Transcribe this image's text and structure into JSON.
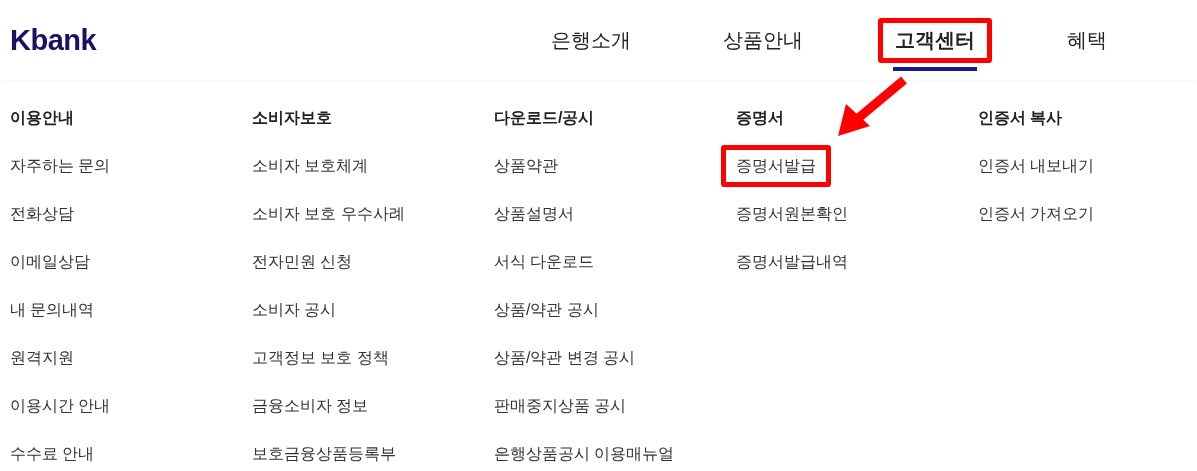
{
  "logo": "Kbank",
  "nav": [
    {
      "label": "은행소개",
      "selected": false,
      "highlighted": false
    },
    {
      "label": "상품안내",
      "selected": false,
      "highlighted": false
    },
    {
      "label": "고객센터",
      "selected": true,
      "highlighted": true
    },
    {
      "label": "혜택",
      "selected": false,
      "highlighted": false
    }
  ],
  "menu_columns": [
    {
      "heading": "이용안내",
      "items": [
        {
          "label": "자주하는 문의",
          "highlighted": false
        },
        {
          "label": "전화상담",
          "highlighted": false
        },
        {
          "label": "이메일상담",
          "highlighted": false
        },
        {
          "label": "내 문의내역",
          "highlighted": false
        },
        {
          "label": "원격지원",
          "highlighted": false
        },
        {
          "label": "이용시간 안내",
          "highlighted": false
        },
        {
          "label": "수수료 안내",
          "highlighted": false
        }
      ]
    },
    {
      "heading": "소비자보호",
      "items": [
        {
          "label": "소비자 보호체계",
          "highlighted": false
        },
        {
          "label": "소비자 보호 우수사례",
          "highlighted": false
        },
        {
          "label": "전자민원 신청",
          "highlighted": false
        },
        {
          "label": "소비자 공시",
          "highlighted": false
        },
        {
          "label": "고객정보 보호 정책",
          "highlighted": false
        },
        {
          "label": "금융소비자 정보",
          "highlighted": false
        },
        {
          "label": "보호금융상품등록부",
          "highlighted": false
        }
      ]
    },
    {
      "heading": "다운로드/공시",
      "items": [
        {
          "label": "상품약관",
          "highlighted": false
        },
        {
          "label": "상품설명서",
          "highlighted": false
        },
        {
          "label": "서식 다운로드",
          "highlighted": false
        },
        {
          "label": "상품/약관 공시",
          "highlighted": false
        },
        {
          "label": "상품/약관 변경 공시",
          "highlighted": false
        },
        {
          "label": "판매중지상품 공시",
          "highlighted": false
        },
        {
          "label": "은행상품공시 이용매뉴얼",
          "highlighted": false
        }
      ]
    },
    {
      "heading": "증명서",
      "items": [
        {
          "label": "증명서발급",
          "highlighted": true
        },
        {
          "label": "증명서원본확인",
          "highlighted": false
        },
        {
          "label": "증명서발급내역",
          "highlighted": false
        }
      ]
    },
    {
      "heading": "인증서 복사",
      "items": [
        {
          "label": "인증서 내보내기",
          "highlighted": false
        },
        {
          "label": "인증서 가져오기",
          "highlighted": false
        }
      ]
    }
  ]
}
